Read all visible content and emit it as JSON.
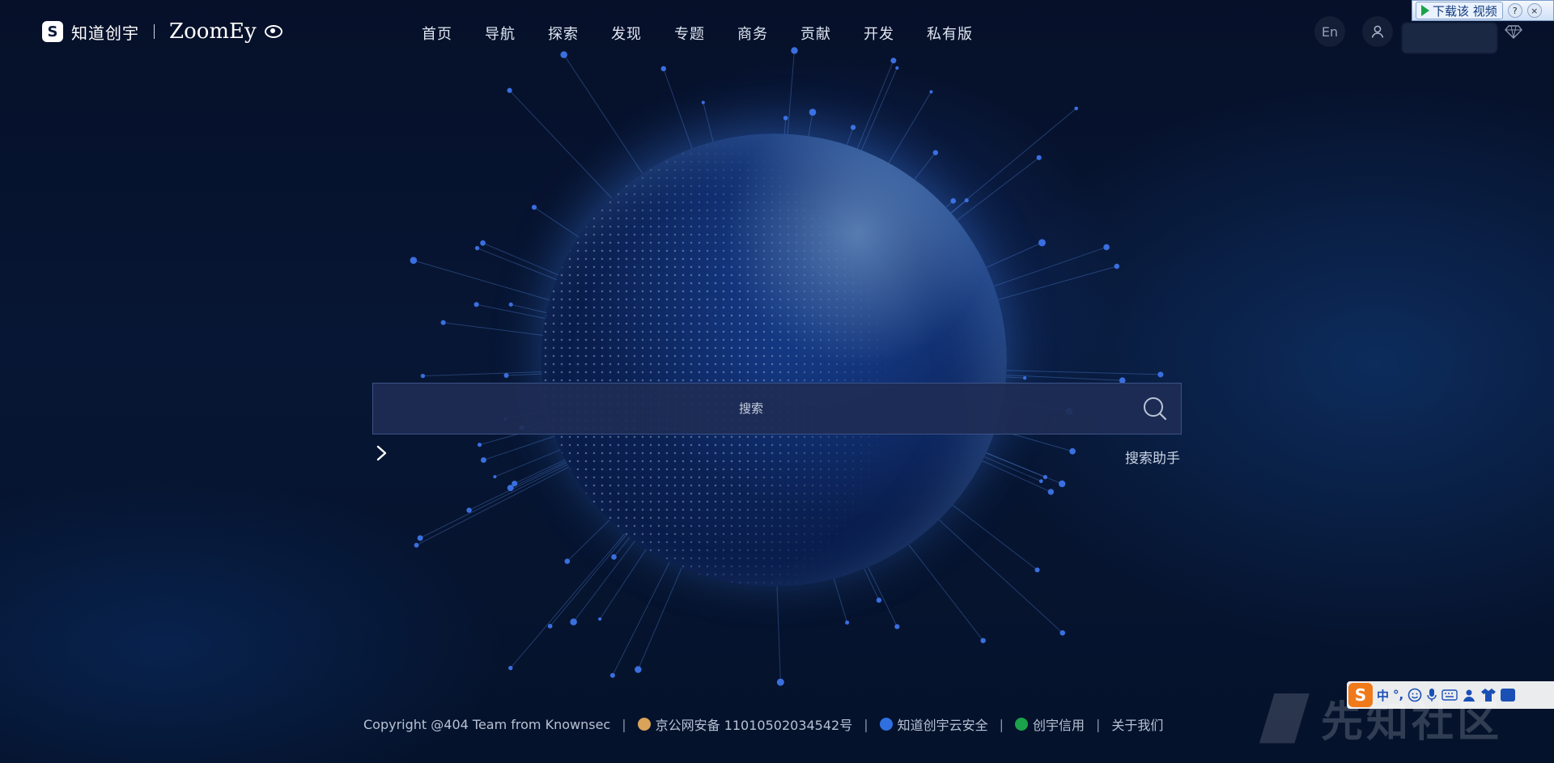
{
  "brand": {
    "logo_text": "S",
    "cn_name": "知道创宇",
    "en_name": "ZoomEy"
  },
  "nav": {
    "items": [
      "首页",
      "导航",
      "探索",
      "发现",
      "专题",
      "商务",
      "贡献",
      "开发",
      "私有版"
    ]
  },
  "header_right": {
    "lang_label": "En"
  },
  "download_bar": {
    "label": "下载该 视频",
    "help": "?",
    "close": "×"
  },
  "search": {
    "placeholder": "搜索",
    "assistant_label": "搜索助手"
  },
  "footer": {
    "copyright": "Copyright @404 Team from Knownsec",
    "icp": "京公网安备 11010502034542号",
    "cloud": "知道创宇云安全",
    "credit": "创宇信用",
    "about": "关于我们",
    "separator": "|"
  },
  "ime": {
    "logo": "S",
    "mode": "中",
    "punct": "°,"
  },
  "watermark": {
    "text": "先知社区"
  },
  "colors": {
    "accent": "#2f6fe0",
    "background": "#061029",
    "ime_orange": "#f07a1a"
  }
}
